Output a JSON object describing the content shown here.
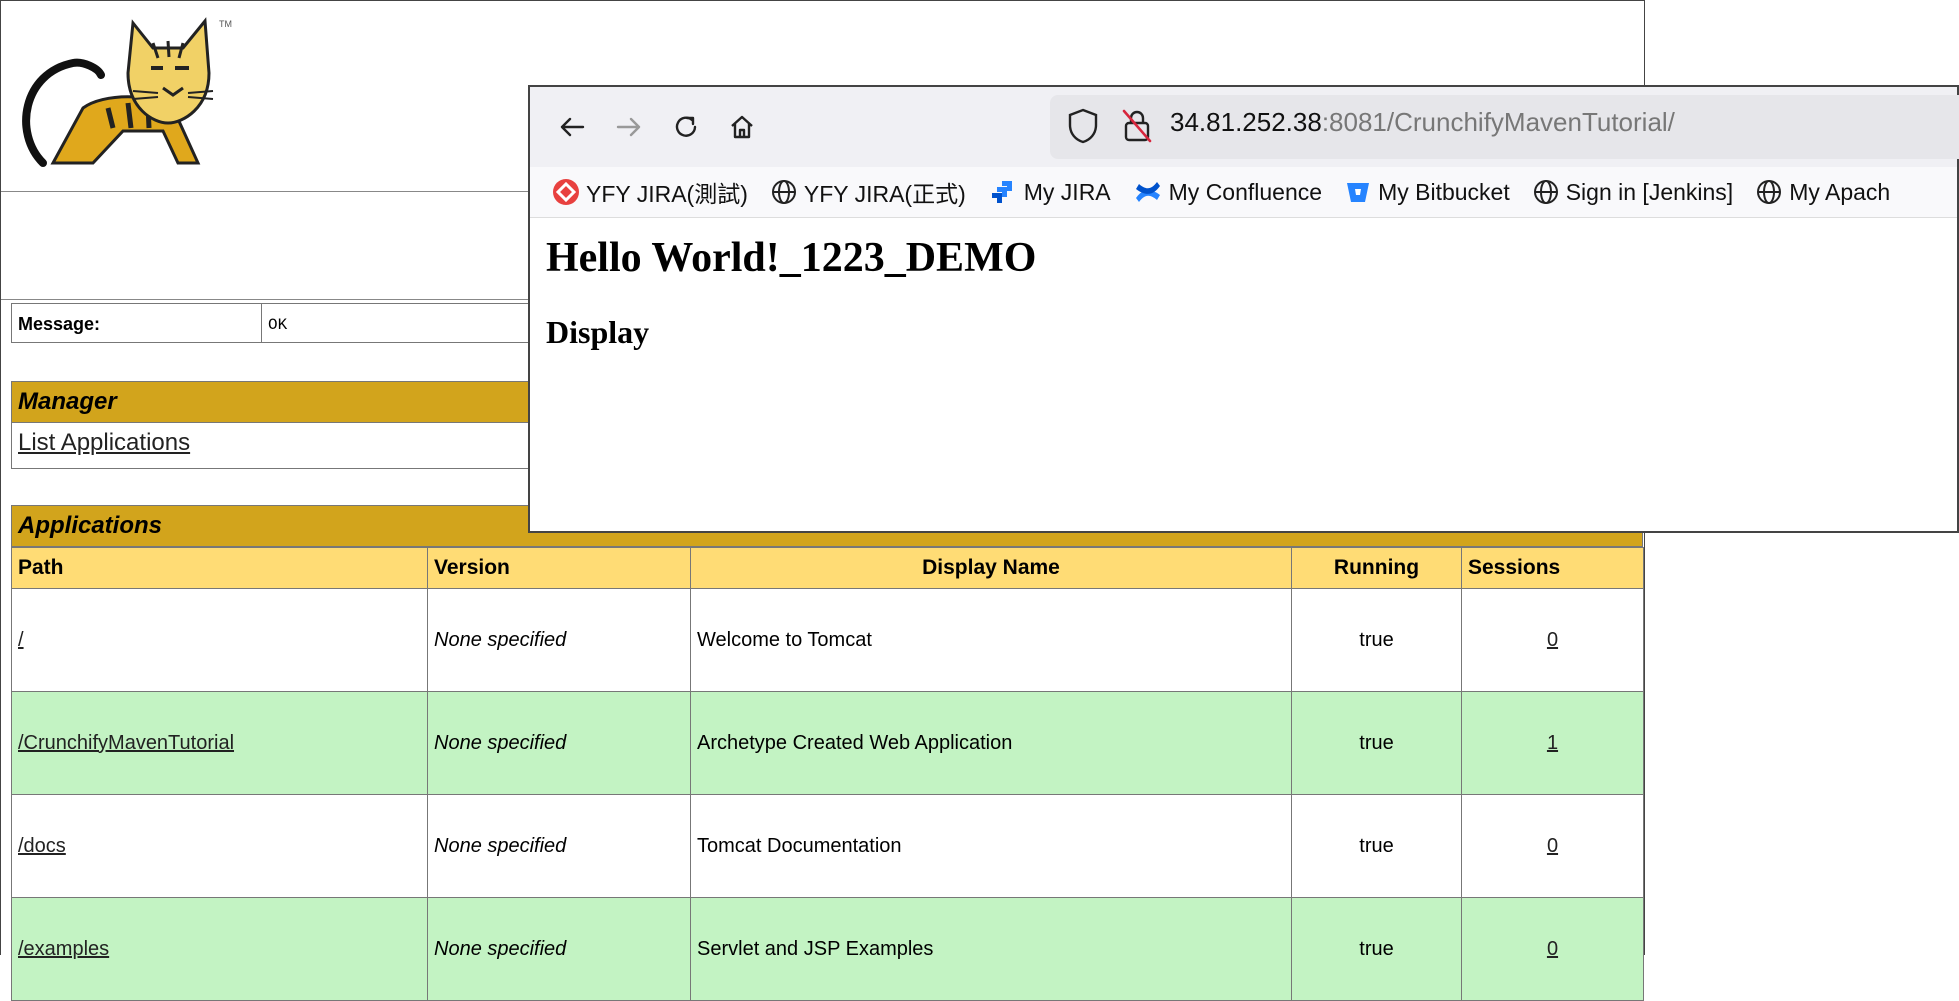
{
  "manager": {
    "message_label": "Message:",
    "message_value": "OK",
    "logo_tm": "TM",
    "section_manager": "Manager",
    "list_applications": "List Applications",
    "section_applications": "Applications",
    "columns": [
      "Path",
      "Version",
      "Display Name",
      "Running",
      "Sessions"
    ],
    "rows": [
      {
        "path": "/",
        "version": "None specified",
        "display_name": "Welcome to Tomcat",
        "running": "true",
        "sessions": "0"
      },
      {
        "path": "/CrunchifyMavenTutorial",
        "version": "None specified",
        "display_name": "Archetype Created Web Application",
        "running": "true",
        "sessions": "1"
      },
      {
        "path": "/docs",
        "version": "None specified",
        "display_name": "Tomcat Documentation",
        "running": "true",
        "sessions": "0"
      },
      {
        "path": "/examples",
        "version": "None specified",
        "display_name": "Servlet and JSP Examples",
        "running": "true",
        "sessions": "0"
      }
    ],
    "colors": {
      "section_bg": "#d2a41c",
      "header_bg": "#ffdc75",
      "row_alt_bg": "#c3f3c3"
    }
  },
  "browser": {
    "url_host": "34.81.252.38",
    "url_rest": ":8081/CrunchifyMavenTutorial/",
    "bookmarks": [
      {
        "label": "YFY JIRA(測試)",
        "icon": "red-diamond-icon"
      },
      {
        "label": "YFY JIRA(正式)",
        "icon": "globe-icon"
      },
      {
        "label": "My JIRA",
        "icon": "jira-icon"
      },
      {
        "label": "My Confluence",
        "icon": "confluence-icon"
      },
      {
        "label": "My Bitbucket",
        "icon": "bitbucket-icon"
      },
      {
        "label": "Sign in [Jenkins]",
        "icon": "globe-icon"
      },
      {
        "label": "My Apach",
        "icon": "globe-icon"
      }
    ],
    "page_heading": "Hello World!_1223_DEMO",
    "page_subheading": "Display"
  }
}
